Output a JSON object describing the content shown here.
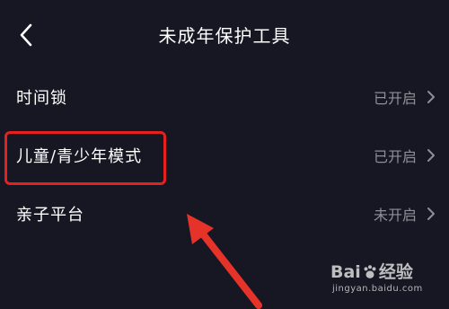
{
  "header": {
    "title": "未成年保护工具",
    "back_icon": "chevron-left-icon"
  },
  "settings": [
    {
      "label": "时间锁",
      "status": "已开启"
    },
    {
      "label": "儿童/青少年模式",
      "status": "已开启"
    },
    {
      "label": "亲子平台",
      "status": "未开启"
    }
  ],
  "watermark": {
    "brand_prefix": "Bai",
    "brand_suffix": "经验",
    "url": "jingyan.baidu.com"
  },
  "colors": {
    "background": "#161722",
    "status_text": "#8e8f97",
    "highlight": "#e5211f",
    "arrow": "#e5332a"
  }
}
